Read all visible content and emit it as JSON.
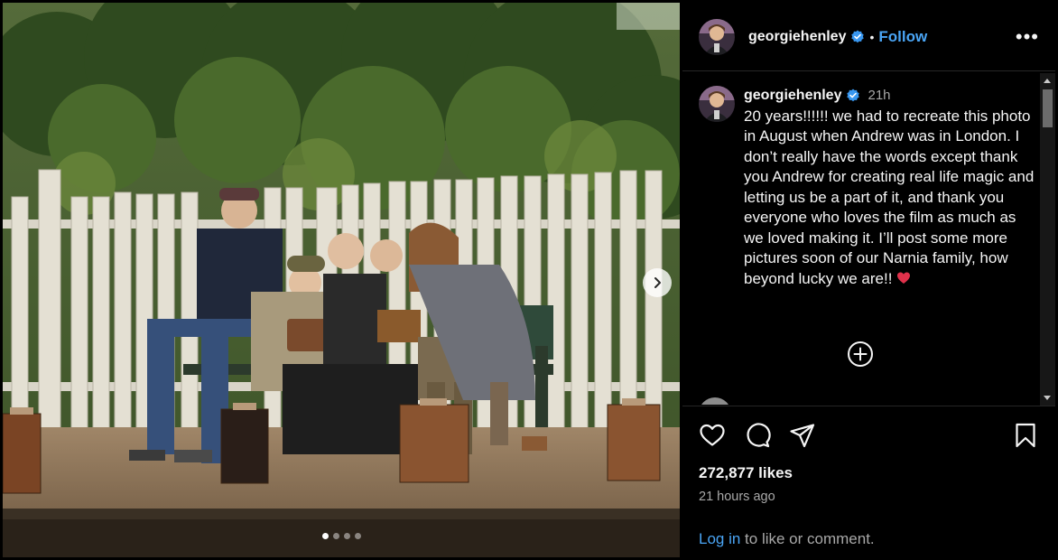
{
  "post": {
    "username": "georgiehenley",
    "follow_label": "Follow",
    "separator": "•",
    "more_label": "•••"
  },
  "caption": {
    "username": "georgiehenley",
    "time": "21h",
    "text": "20 years!!!!!! we had to recreate this photo in August when Andrew was in London. I don’t really have the words except thank you Andrew for creating real life magic and letting us be a part of it, and thank you everyone who loves the film as much as we loved making it. I’ll post some more pictures soon of our Narnia family, how beyond lucky we are!! ",
    "emoji": "heart-emoji"
  },
  "engagement": {
    "likes": "272,877 likes",
    "time_ago": "21 hours ago",
    "login_link": "Log in",
    "login_suffix": " to like or comment."
  },
  "carousel": {
    "slide_count": 4,
    "active_index": 0
  },
  "icons": {
    "like": "heart-icon",
    "comment": "comment-icon",
    "share": "share-icon",
    "save": "bookmark-icon",
    "more": "more-options-icon",
    "load_more": "plus-circle-icon",
    "next": "chevron-right-icon",
    "verified": "verified-badge-icon"
  },
  "colors": {
    "background": "#000000",
    "link": "#4aa5f5",
    "verified": "#3897f0",
    "secondary_text": "#a8a8a8",
    "divider": "#262626"
  }
}
